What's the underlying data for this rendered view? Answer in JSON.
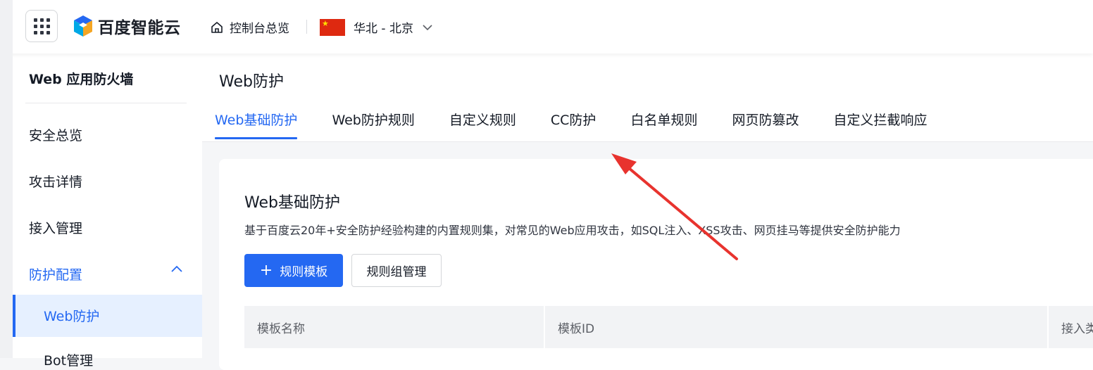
{
  "topbar": {
    "brand": "百度智能云",
    "home_label": "控制台总览",
    "region_label": "华北 - 北京",
    "icons": {
      "apps": "apps-grid-icon",
      "home": "home-icon",
      "flag": "china-flag-icon",
      "dropdown": "chevron-down-icon"
    }
  },
  "sidebar": {
    "title": "Web 应用防火墙",
    "items": [
      {
        "label": "安全总览"
      },
      {
        "label": "攻击详情"
      },
      {
        "label": "接入管理"
      },
      {
        "label": "防护配置",
        "expanded": true
      }
    ],
    "sub_items": [
      {
        "label": "Web防护",
        "active": true
      },
      {
        "label": "Bot管理"
      }
    ]
  },
  "main": {
    "page_title": "Web防护",
    "tabs": [
      {
        "label": "Web基础防护",
        "active": true
      },
      {
        "label": "Web防护规则"
      },
      {
        "label": "自定义规则"
      },
      {
        "label": "CC防护"
      },
      {
        "label": "白名单规则"
      },
      {
        "label": "网页防篡改"
      },
      {
        "label": "自定义拦截响应"
      }
    ],
    "card": {
      "title": "Web基础防护",
      "description": "基于百度云20年+安全防护经验构建的内置规则集，对常见的Web应用攻击，如SQL注入、XSS攻击、网页挂马等提供安全防护能力",
      "primary_button": "规则模板",
      "secondary_button": "规则组管理",
      "table_columns": [
        "模板名称",
        "模板ID",
        "接入类"
      ]
    }
  },
  "colors": {
    "accent": "#2468f2",
    "annotation_arrow": "#e8332e"
  }
}
